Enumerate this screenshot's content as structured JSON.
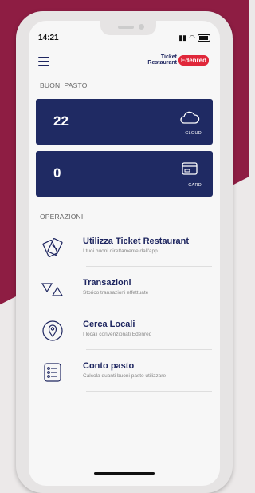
{
  "status": {
    "time": "14:21"
  },
  "header": {
    "menu_icon": "hamburger-icon",
    "logo_line1": "Ticket",
    "logo_line2": "Restaurant",
    "logo_badge": "Edenred"
  },
  "buoni": {
    "section_label": "BUONI PASTO",
    "cloud": {
      "value": "22",
      "label": "CLOUD",
      "icon": "cloud-icon"
    },
    "card": {
      "value": "0",
      "label": "CARD",
      "icon": "card-icon"
    }
  },
  "operazioni": {
    "section_label": "OPERAZIONI",
    "items": [
      {
        "title": "Utilizza Ticket Restaurant",
        "subtitle": "I tuoi buoni direttamente dall'app",
        "icon": "tickets-icon"
      },
      {
        "title": "Transazioni",
        "subtitle": "Storico transazioni effettuate",
        "icon": "transactions-icon"
      },
      {
        "title": "Cerca Locali",
        "subtitle": "I locali convenzionati Edenred",
        "icon": "location-icon"
      },
      {
        "title": "Conto pasto",
        "subtitle": "Calcola quanti buoni pasto utilizzare",
        "icon": "checklist-icon"
      }
    ]
  },
  "colors": {
    "brand_navy": "#1f2a63",
    "maroon": "#8e1d43",
    "edenred_red": "#e0273a"
  }
}
